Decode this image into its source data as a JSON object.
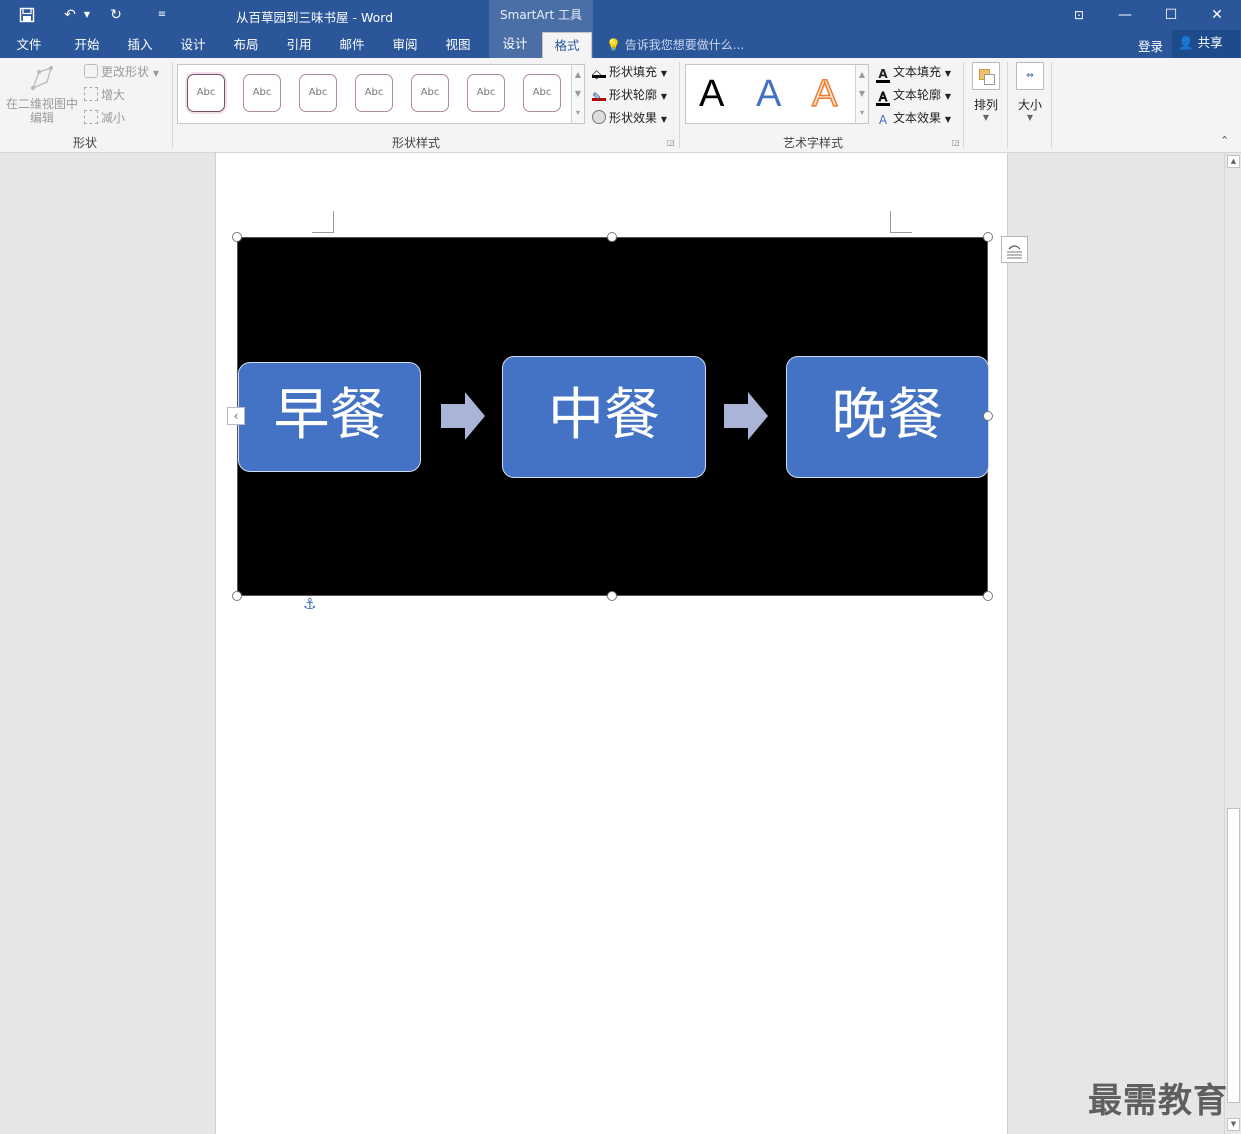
{
  "window": {
    "title": "从百草园到三味书屋 - Word",
    "context_group": "SmartArt 工具",
    "tellme_placeholder": "告诉我您想要做什么...",
    "login": "登录",
    "share": "共享"
  },
  "tabs": [
    "文件",
    "开始",
    "插入",
    "设计",
    "布局",
    "引用",
    "邮件",
    "审阅",
    "视图",
    "设计",
    "格式"
  ],
  "active_tab": "格式",
  "ribbon": {
    "shapes_group": {
      "label": "形状",
      "edit_2d_line1": "在二维视图中",
      "edit_2d_line2": "编辑",
      "change_shape": "更改形状",
      "larger": "增大",
      "smaller": "减小"
    },
    "shape_styles_group": {
      "label": "形状样式",
      "gallery_items": [
        "Abc",
        "Abc",
        "Abc",
        "Abc",
        "Abc",
        "Abc",
        "Abc"
      ],
      "fill": "形状填充",
      "outline": "形状轮廓",
      "effects": "形状效果"
    },
    "wordart_group": {
      "label": "艺术字样式",
      "gallery_items": [
        "A",
        "A",
        "A"
      ],
      "text_fill": "文本填充",
      "text_outline": "文本轮廓",
      "text_effects": "文本效果"
    },
    "arrange": "排列",
    "size": "大小"
  },
  "smartart": {
    "steps": [
      "早餐",
      "中餐",
      "晚餐"
    ],
    "colors": {
      "box": "#4472c4",
      "arrow": "#a9b4d6",
      "canvas": "#000000"
    }
  },
  "watermark": "最需教育"
}
